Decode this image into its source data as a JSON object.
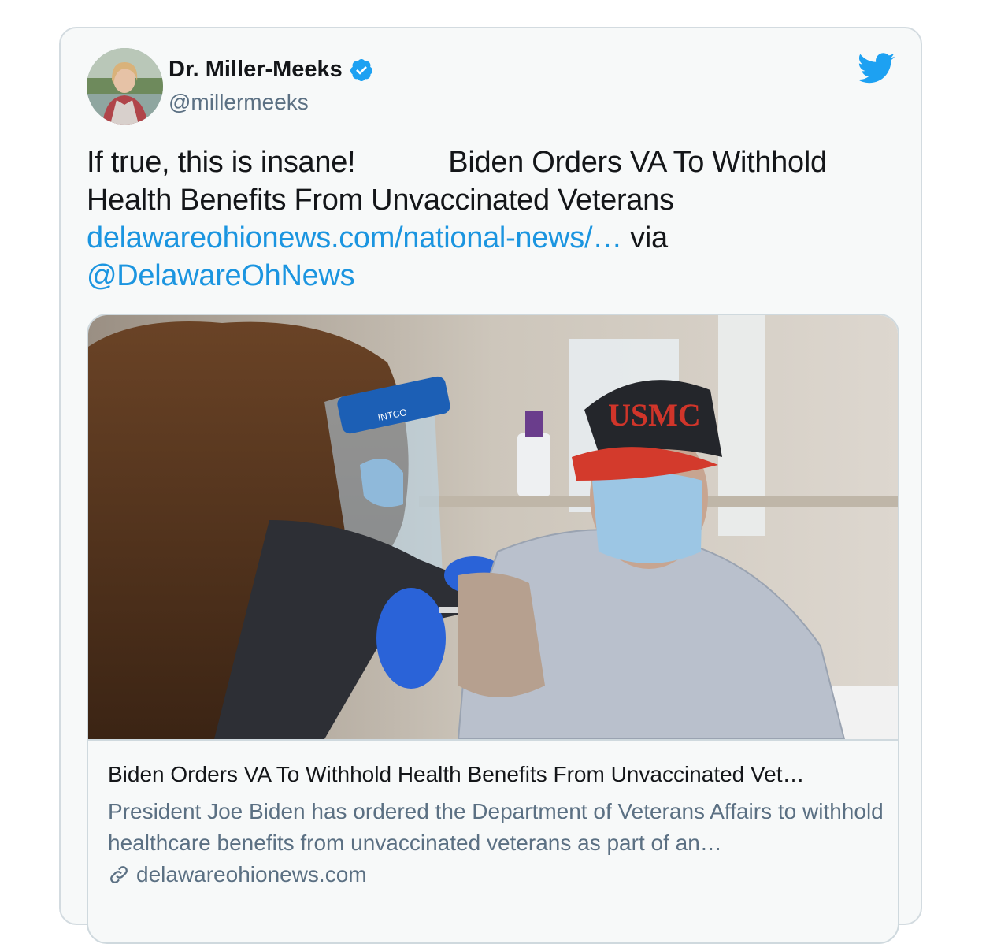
{
  "tweet": {
    "author_name": "Dr. Miller-Meeks",
    "author_handle": "@millermeeks",
    "text_part1": "If true, this is insane!",
    "text_part2": "Biden Orders VA To Withhold Health Benefits From Unvaccinated Veterans",
    "link_text": "delawareohionews.com/national-news/…",
    "via_text": "via",
    "mention": "@DelawareOhNews"
  },
  "card": {
    "title": "Biden Orders VA To Withhold Health Benefits From Unvaccinated Vet…",
    "description": "President Joe Biden has ordered the Department of Veterans Affairs to withhold healthcare benefits from unvaccinated veterans as part of an…",
    "domain": "delawareohionews.com",
    "image_cap_text": "USMC",
    "image_shield_text": "INTCO"
  },
  "icons": {
    "verified": "verified-badge-icon",
    "platform": "twitter-bird-icon",
    "link": "link-chain-icon"
  },
  "colors": {
    "link": "#1b95e0",
    "verified": "#1da1f2",
    "bird": "#1da1f2",
    "secondary_text": "#5b7083"
  }
}
